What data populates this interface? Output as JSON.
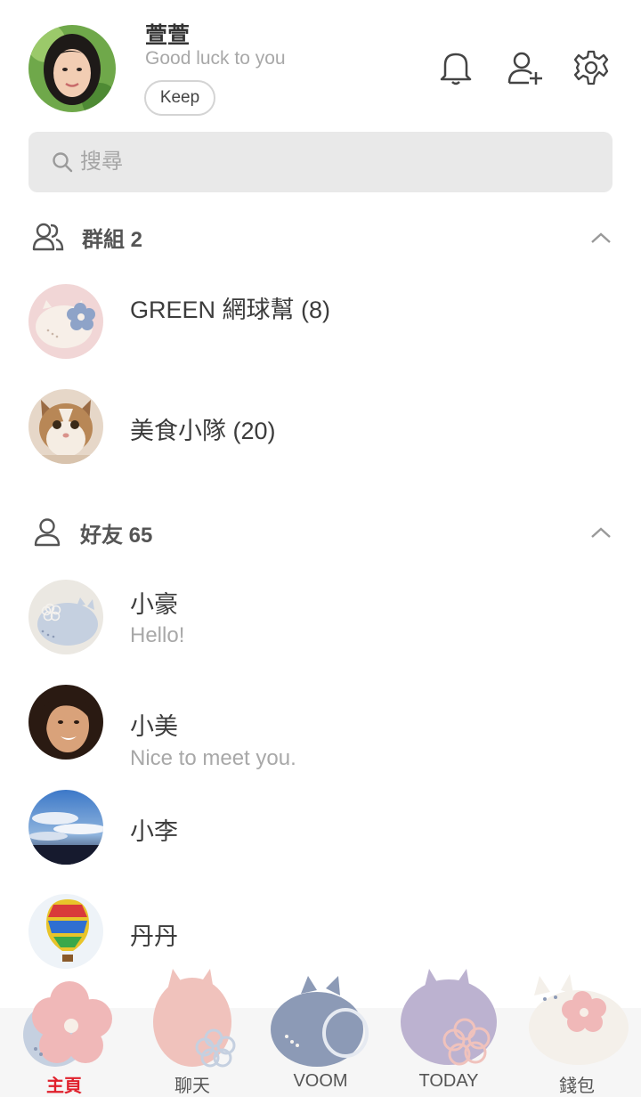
{
  "profile": {
    "name": "萱萱",
    "status": "Good luck to you",
    "keep_label": "Keep"
  },
  "header_icons": [
    "bell-icon",
    "add-friend-icon",
    "gear-icon"
  ],
  "search": {
    "placeholder": "搜尋"
  },
  "groups": {
    "title": "群組 2",
    "items": [
      {
        "name": "GREEN 網球幫 (8)"
      },
      {
        "name": "美食小隊 (20)"
      }
    ]
  },
  "friends": {
    "title": "好友 65",
    "items": [
      {
        "name": "小豪",
        "message": "Hello!"
      },
      {
        "name": "小美",
        "message": "Nice to meet you."
      },
      {
        "name": "小李",
        "message": ""
      },
      {
        "name": "丹丹",
        "message": ""
      }
    ]
  },
  "bottom_nav": {
    "items": [
      {
        "label": "主頁",
        "active": true
      },
      {
        "label": "聊天",
        "active": false
      },
      {
        "label": "VOOM",
        "active": false
      },
      {
        "label": "TODAY",
        "active": false
      },
      {
        "label": "錢包",
        "active": false
      }
    ]
  },
  "colors": {
    "active_tab": "#e0202c",
    "search_bg": "#e9e9e9",
    "muted_text": "#a8a8a8"
  }
}
